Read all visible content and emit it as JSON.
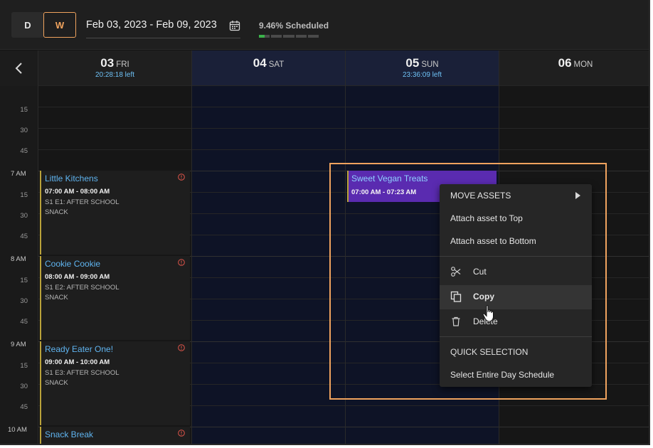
{
  "toolbar": {
    "day_label": "D",
    "week_label": "W",
    "date_range": "Feb 03, 2023 - Feb 09, 2023",
    "scheduled_text": "9.46% Scheduled",
    "scheduled_fraction": 0.0946
  },
  "days": [
    {
      "num": "03",
      "name": "FRI",
      "left": "20:28:18 left"
    },
    {
      "num": "04",
      "name": "SAT",
      "left": ""
    },
    {
      "num": "05",
      "name": "SUN",
      "left": "23:36:09 left"
    },
    {
      "num": "06",
      "name": "MON",
      "left": ""
    }
  ],
  "time_labels": {
    "t1": "15",
    "t2": "30",
    "t3": "45",
    "h7": "7 AM",
    "t7a": "15",
    "t7b": "30",
    "t7c": "45",
    "h8": "8 AM",
    "t8a": "15",
    "t8b": "30",
    "t8c": "45",
    "h9": "9 AM",
    "t9a": "15",
    "t9b": "30",
    "t9c": "45",
    "h10": "10 AM"
  },
  "events": [
    {
      "title": "Little Kitchens",
      "time": "07:00 AM - 08:00 AM",
      "line1": "S1 E1: AFTER SCHOOL",
      "line2": "SNACK"
    },
    {
      "title": "Cookie Cookie",
      "time": "08:00 AM - 09:00 AM",
      "line1": "S1 E2: AFTER SCHOOL",
      "line2": "SNACK"
    },
    {
      "title": "Ready Eater One!",
      "time": "09:00 AM - 10:00 AM",
      "line1": "S1 E3: AFTER SCHOOL",
      "line2": "SNACK"
    },
    {
      "title": "Snack Break"
    }
  ],
  "vegan_event": {
    "title": "Sweet Vegan Treats",
    "time": "07:00 AM - 07:23 AM"
  },
  "context_menu": {
    "move_assets": "MOVE ASSETS",
    "attach_top": "Attach asset to Top",
    "attach_bottom": "Attach asset to Bottom",
    "cut": "Cut",
    "copy": "Copy",
    "delete": "Delete",
    "quick_selection": "QUICK SELECTION",
    "select_day": "Select Entire Day Schedule"
  },
  "colors": {
    "accent": "#f0a35e",
    "link": "#5fb4f0",
    "event_purple": "#5a2bb0",
    "progress_green": "#3bb24a"
  }
}
